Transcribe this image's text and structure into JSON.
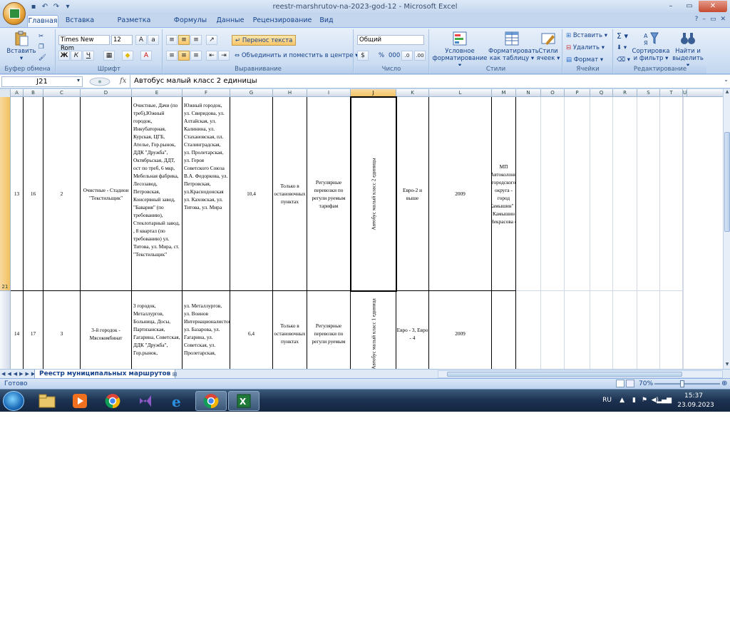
{
  "window": {
    "title": "reestr-marshrutov-na-2023-god-12 - Microsoft Excel"
  },
  "tabs": [
    "Главная",
    "Вставка",
    "Разметка страницы",
    "Формулы",
    "Данные",
    "Рецензирование",
    "Вид"
  ],
  "ribbon": {
    "clipboard": {
      "paste": "Вставить",
      "label": "Буфер обмена"
    },
    "font": {
      "name": "Times New Rom",
      "size": "12",
      "bold": "Ж",
      "italic": "К",
      "underline": "Ч",
      "label": "Шрифт"
    },
    "alignment": {
      "wrap": "Перенос текста",
      "merge": "Объединить и поместить в центре",
      "label": "Выравнивание"
    },
    "number": {
      "format": "Общий",
      "percent": "%",
      "thousands": "000",
      "label": "Число"
    },
    "styles": {
      "conditional": "Условное форматирование",
      "as_table": "Форматировать как таблицу",
      "cell_styles": "Стили ячеек",
      "label": "Стили"
    },
    "cells": {
      "insert": "Вставить",
      "delete": "Удалить",
      "format": "Формат",
      "label": "Ячейки"
    },
    "editing": {
      "sort": "Сортировка и фильтр",
      "find": "Найти и выделить",
      "label": "Редактирование"
    }
  },
  "formula_bar": {
    "cell_ref": "J21",
    "fx": "fx",
    "content": "Автобус малый класс 2 единицы"
  },
  "columns": [
    "A",
    "B",
    "C",
    "D",
    "E",
    "F",
    "G",
    "H",
    "I",
    "J",
    "K",
    "L",
    "M",
    "N",
    "O",
    "P",
    "Q",
    "R",
    "S",
    "T",
    "U"
  ],
  "rows": [
    {
      "row_num": "21",
      "a": "13",
      "b": "16",
      "c": "2",
      "d": "Очистные - Стадион \"Текстильщик\"",
      "e": "Очистные,  Дачи (по треб),Южный городок, Инкубаторная, Курская, ЦГБ, Ателье, Гор.рынок, ДДК \"Дружба\", Октябрьская, ДДТ, ост по треб, 6 мкр, Мебельная фабрика, Лесозавод, Петровская, Консервный завод, \"Бавария\" (по требованию), Стеклотарный завод, ,  8 квартал (по требованию) ул. Титова, ул. Мира, ст. \"Текстильщик\"",
      "f": "Южный городок, ул. Свиридова, ул. Алтайская, ул. Калинина, ул. Стахановская, пл. Сталинградская, ул. Пролетарская, ул. Героя Советского Союза В.А. Федоркова, ул. Петровская, ул.Краснодонская ул. Каховская, ул. Титова, ул. Мира",
      "g": "10,4",
      "h": "Только в остановочных пунктах",
      "i": "Регулярные перевозки по регули руемым тарифам",
      "j": "Автобус малый класс 2 единицы",
      "k": "Евро-2 и выше",
      "l": "2009",
      "m": "МП \"Автоколонна городского округа - город Камышин\" г. Камышин Некрасова 4"
    },
    {
      "row_num": "",
      "a": "14",
      "b": "17",
      "c": "3",
      "d": "3-й городок - Мясокомбинат",
      "e": "3 городок, Металлургов, Больница, Досы, Партизанская, Гагарина, Советская, ДДК \"Дружба\", Гор.рынок,",
      "f": "ул. Металлургов, ул. Воинов Интернационалистов, ул. Базарова, ул. Гагарина, ул. Советская, ул. Пролетарская,",
      "g": "6,4",
      "h": "Только в остановочных пунктах",
      "i": "Регулярные перевозки по регули руемым",
      "j": "Автобус малый класс 1 единица",
      "k": "Евро - 3, Евро - 4",
      "l": "2009",
      "m": ""
    }
  ],
  "sheet_tab": "Реестр муниципальных маршрутов",
  "status": {
    "ready": "Готово",
    "zoom": "70%"
  },
  "tray": {
    "lang": "RU",
    "time": "15:37",
    "date": "23.09.2023"
  }
}
